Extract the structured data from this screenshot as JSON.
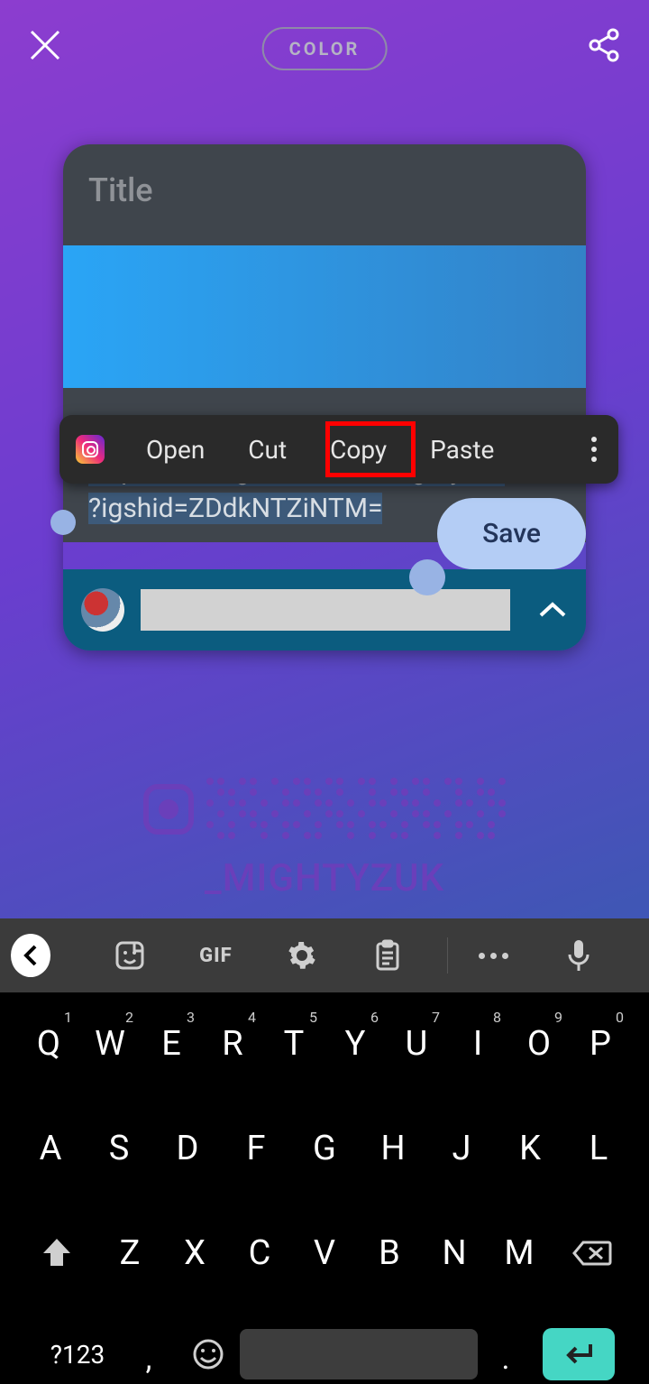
{
  "header": {
    "color_label": "COLOR"
  },
  "card": {
    "title_placeholder": "Title",
    "username": "_mightyzuk",
    "url_line1": "https://instagram.com/_mightyzuk",
    "url_line2": "?igshid=ZDdkNTZiNTM=",
    "save_label": "Save"
  },
  "qr": {
    "label": "_MIGHTYZUK"
  },
  "context_menu": {
    "open": "Open",
    "cut": "Cut",
    "copy": "Copy",
    "paste": "Paste"
  },
  "keyboard": {
    "gif": "GIF",
    "symbols": "?123",
    "comma": ",",
    "period": ".",
    "row1": [
      {
        "k": "Q",
        "s": "1"
      },
      {
        "k": "W",
        "s": "2"
      },
      {
        "k": "E",
        "s": "3"
      },
      {
        "k": "R",
        "s": "4"
      },
      {
        "k": "T",
        "s": "5"
      },
      {
        "k": "Y",
        "s": "6"
      },
      {
        "k": "U",
        "s": "7"
      },
      {
        "k": "I",
        "s": "8"
      },
      {
        "k": "O",
        "s": "9"
      },
      {
        "k": "P",
        "s": "0"
      }
    ],
    "row2": [
      "A",
      "S",
      "D",
      "F",
      "G",
      "H",
      "J",
      "K",
      "L"
    ],
    "row3": [
      "Z",
      "X",
      "C",
      "V",
      "B",
      "N",
      "M"
    ]
  }
}
